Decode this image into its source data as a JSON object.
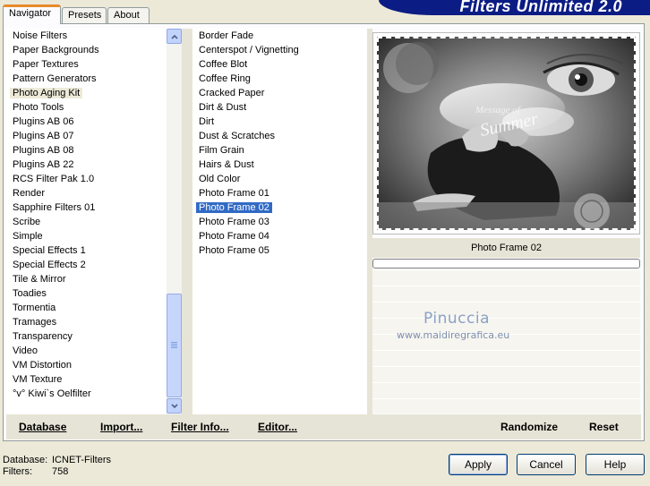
{
  "tabs": [
    {
      "label": "Navigator",
      "active": true
    },
    {
      "label": "Presets",
      "active": false
    },
    {
      "label": "About",
      "active": false
    }
  ],
  "banner": {
    "title": "Filters Unlimited 2.0"
  },
  "categories": [
    "Noise Filters",
    "Paper Backgrounds",
    "Paper Textures",
    "Pattern Generators",
    "Photo Aging Kit",
    "Photo Tools",
    "Plugins AB 06",
    "Plugins AB 07",
    "Plugins AB 08",
    "Plugins AB 22",
    "RCS Filter Pak 1.0",
    "Render",
    "Sapphire Filters 01",
    "Scribe",
    "Simple",
    "Special Effects 1",
    "Special Effects 2",
    "Tile & Mirror",
    "Toadies",
    "Tormentia",
    "Tramages",
    "Transparency",
    "Video",
    "VM Distortion",
    "VM Texture",
    "°v° Kiwi`s Oelfilter"
  ],
  "categories_highlighted": "Photo Aging Kit",
  "filters": [
    "Border Fade",
    "Centerspot / Vignetting",
    "Coffee Blot",
    "Coffee Ring",
    "Cracked Paper",
    "Dirt & Dust",
    "Dirt",
    "Dust & Scratches",
    "Film Grain",
    "Hairs & Dust",
    "Old Color",
    "Photo Frame 01",
    "Photo Frame 02",
    "Photo Frame 03",
    "Photo Frame 04",
    "Photo Frame 05"
  ],
  "filters_selected": "Photo Frame 02",
  "preview": {
    "filter_name": "Photo Frame 02",
    "image_text_line1": "Message of",
    "image_text_line2": "Summer"
  },
  "watermark": {
    "name": "Pinuccia",
    "url": "www.maidiregrafica.eu"
  },
  "actions": {
    "database": "Database",
    "import": "Import...",
    "filter_info": "Filter Info...",
    "editor": "Editor...",
    "randomize": "Randomize",
    "reset": "Reset"
  },
  "status": {
    "database_label": "Database:",
    "database_value": "ICNET-Filters",
    "filters_label": "Filters:",
    "filters_value": "758"
  },
  "buttons": {
    "apply": "Apply",
    "cancel": "Cancel",
    "help": "Help"
  },
  "colors": {
    "banner": "#0b1c84",
    "selection": "#316ac5",
    "tab_accent": "#e68b2c"
  }
}
